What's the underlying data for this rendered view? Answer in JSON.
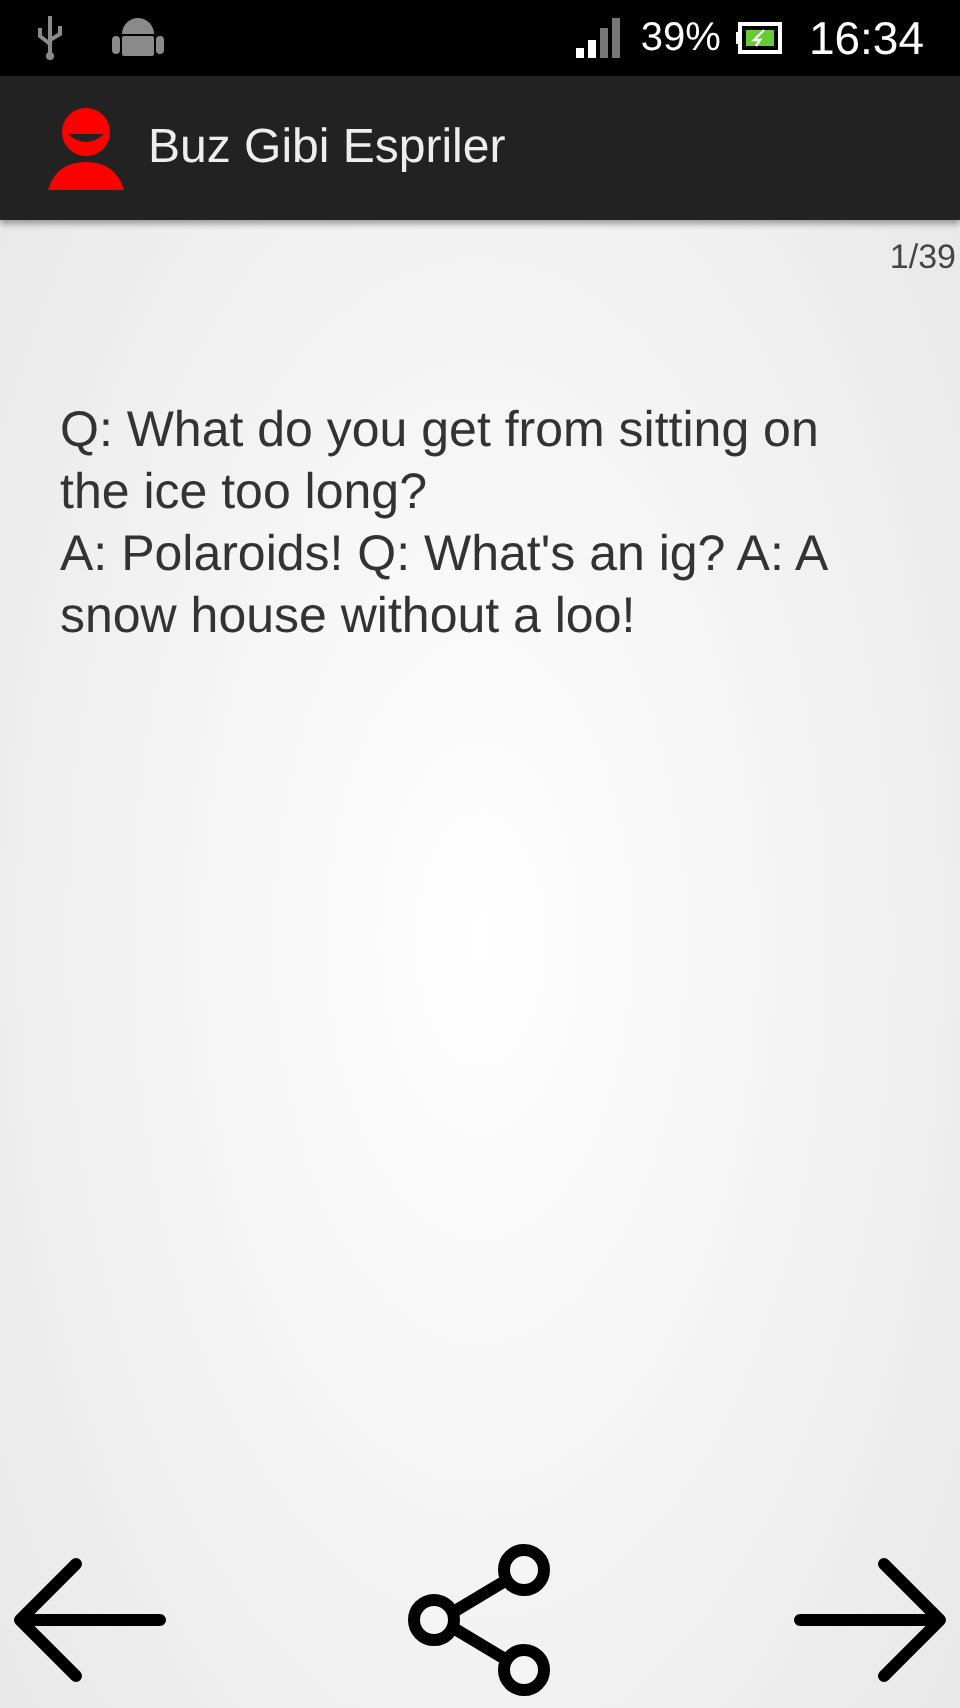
{
  "status_bar": {
    "battery_percent": "39%",
    "time": "16:34"
  },
  "app_bar": {
    "title": "Buz Gibi Espriler"
  },
  "counter": "1/39",
  "joke": "Q: What do you get from sitting on the ice too long?\nA: Polaroids! Q: What's an ig? A: A snow house without a loo!"
}
